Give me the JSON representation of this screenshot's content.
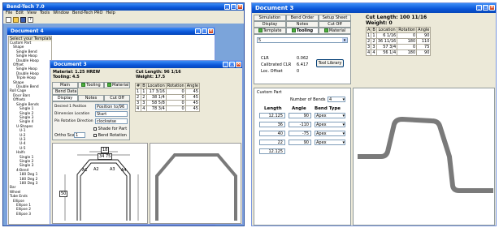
{
  "left": {
    "app_title": "Bend-Tech 7.0",
    "menu": [
      "File",
      "Edit",
      "View",
      "Tools",
      "Window",
      "Bend-Tech PRO",
      "Help"
    ],
    "doc_title": "Document 4",
    "tree_header": "Select your Template",
    "tree": [
      "Custom Part",
      "Shape",
      "Single Bend",
      "Single Hoop",
      "Double Hoop",
      "Offset",
      "Single Hoop",
      "Double Hoop",
      "Triple Hoop",
      "Shape",
      "Double Bend",
      "Roll Cage",
      "Door Bars",
      "Offsets",
      "Single Bends",
      "Single 1",
      "Single 2",
      "Single 3",
      "Single 4",
      "U-Shapes",
      "U-1",
      "U-2",
      "U-3",
      "U-4",
      "U-5",
      "Halfs",
      "Single 1",
      "Single 2",
      "Single 3",
      "4-Bend",
      "180 Deg 1",
      "180 Deg 2",
      "180 Deg 3",
      "Bar",
      "Wheel",
      "Tube Ends",
      "Ellipse",
      "Ellipse 1",
      "Ellipse 2",
      "Ellipse 3"
    ],
    "inner_doc_title": "Document 3",
    "material": "Material: 1.25 HREW",
    "tooling": "Tooling: 4.5",
    "cut_length": "Cut Length: 96  1/16",
    "weight": "Weight: 17.5",
    "tabs_row1": [
      "Main",
      "Tooling",
      "Material"
    ],
    "tabs_row2": [
      "Bend Data"
    ],
    "tabs_row3": [
      "Display",
      "Notes",
      "Cut Off"
    ],
    "fields": [
      {
        "label": "Desired 1 Position",
        "value": "Position to/96"
      },
      {
        "label": "Dimension Location",
        "value": "Start"
      },
      {
        "label": "Pin Rotation Direction",
        "value": "clockwise"
      }
    ],
    "checks": [
      "Shade for Part",
      "Bend Rotation"
    ],
    "scale_label": "Ortho Scale",
    "scale_value": "1",
    "table": {
      "headers": [
        "#",
        "B",
        "Location",
        "Rotation",
        "Angle"
      ],
      "rows": [
        [
          "1",
          "1",
          "17 3/16",
          "0",
          "45"
        ],
        [
          "2",
          "2",
          "38 1/4",
          "0",
          "45"
        ],
        [
          "3",
          "3",
          "58 5/8",
          "0",
          "45"
        ],
        [
          "4",
          "4",
          "78 3/4",
          "0",
          "45"
        ]
      ]
    },
    "dims": [
      "18",
      "34 75",
      "50"
    ],
    "callouts": [
      "A1",
      "A2",
      "A3",
      "A4"
    ]
  },
  "right": {
    "doc_title": "Document 3",
    "tabs_row1": [
      "Simulation",
      "Bend Order",
      "Setup Sheet"
    ],
    "tabs_row2": [
      "Display",
      "Notes",
      "Cut Off"
    ],
    "tabs_row3": [
      "Template",
      "Tooling",
      "Material"
    ],
    "cut_length": "Cut Length: 100  11/16",
    "weight": "Weight: 0",
    "table": {
      "headers": [
        "A",
        "B",
        "Location",
        "Rotation",
        "Angle"
      ],
      "rows": [
        [
          "1",
          "1",
          "6  1/16",
          "0",
          "90"
        ],
        [
          "2",
          "2",
          "36  11/16",
          "180",
          "110"
        ],
        [
          "3",
          "3",
          "57  3/4",
          "0",
          "75"
        ],
        [
          "4",
          "4",
          "56  1/4",
          "180",
          "90"
        ]
      ]
    },
    "tooling_select": "5",
    "clr_label": "CLR",
    "clr_value": "0.062",
    "calc_clr_label": "Calibrated CLR",
    "calc_clr_value": "6.417",
    "loc_offset_label": "Loc. Offset",
    "loc_offset_value": "0",
    "tool_library": "Tool Library",
    "custom_part": "Custom Part",
    "num_bends_label": "Number of Bends",
    "num_bends_value": "4",
    "col_length": "Length",
    "col_angle": "Angle",
    "col_bend_type": "Bend Type",
    "rows": [
      {
        "length": "12.125",
        "angle": "90",
        "type": "Apex"
      },
      {
        "length": "36",
        "angle": "-110",
        "type": "Apex"
      },
      {
        "length": "40",
        "angle": "-75",
        "type": "Apex"
      },
      {
        "length": "22",
        "angle": "90",
        "type": "Apex"
      },
      {
        "length": "12.125",
        "angle": "",
        "type": ""
      }
    ]
  }
}
